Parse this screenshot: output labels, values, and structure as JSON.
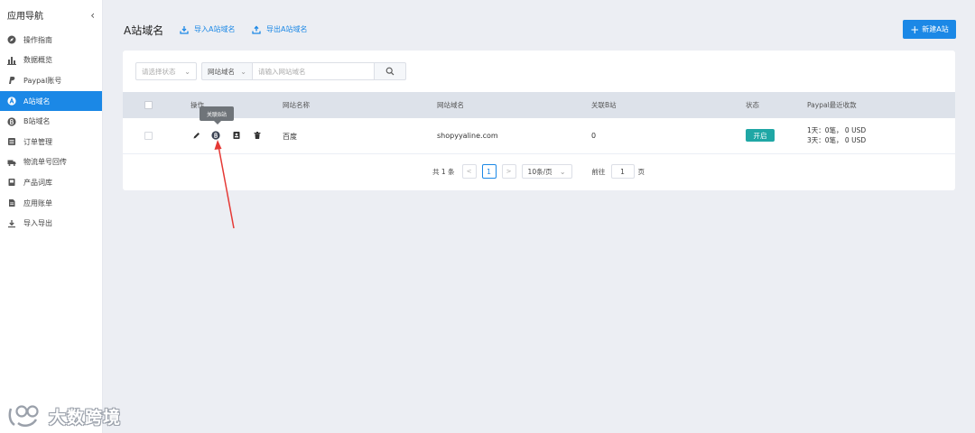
{
  "sidebar": {
    "title": "应用导航",
    "collapse_icon": "chevron-left-icon",
    "items": [
      {
        "label": "操作指南",
        "icon": "compass-icon"
      },
      {
        "label": "数据概览",
        "icon": "bar-chart-icon"
      },
      {
        "label": "Paypal账号",
        "icon": "paypal-icon"
      },
      {
        "label": "A站域名",
        "icon": "letter-a-circle-icon",
        "active": true
      },
      {
        "label": "B站域名",
        "icon": "letter-b-circle-icon"
      },
      {
        "label": "订单管理",
        "icon": "list-icon"
      },
      {
        "label": "物流单号回传",
        "icon": "truck-icon"
      },
      {
        "label": "产品词库",
        "icon": "book-icon"
      },
      {
        "label": "应用账单",
        "icon": "document-icon"
      },
      {
        "label": "导入导出",
        "icon": "download-icon"
      }
    ]
  },
  "header": {
    "title": "A站域名",
    "import_label": "导入A站域名",
    "export_label": "导出A站域名",
    "new_button_label": "新建A站"
  },
  "filters": {
    "status_placeholder": "请选择状态",
    "domain_select_value": "网站域名",
    "search_placeholder": "请输入网站域名"
  },
  "table": {
    "columns": [
      "操作",
      "网站名称",
      "网站域名",
      "关联B站",
      "状态",
      "Paypal最近收款"
    ],
    "rows": [
      {
        "site_name": "百度",
        "domain": "shopyyaline.com",
        "linked_b": "0",
        "status": "开启",
        "paypal_recent": [
          "1天：0笔，  0 USD",
          "3天：0笔，  0 USD"
        ]
      }
    ],
    "action_icons": [
      "edit-icon",
      "link-b-icon",
      "contact-icon",
      "trash-icon"
    ],
    "tooltip": "关联B站"
  },
  "pagination": {
    "total_text": "共 1 条",
    "current_page": "1",
    "page_size": "10条/页",
    "goto_label": "前往",
    "goto_value": "1",
    "page_unit": "页"
  },
  "watermark": {
    "text": "大数跨境"
  },
  "colors": {
    "primary": "#1b88e6",
    "status_on": "#1fa7a5",
    "annotation_arrow": "#e53935"
  }
}
